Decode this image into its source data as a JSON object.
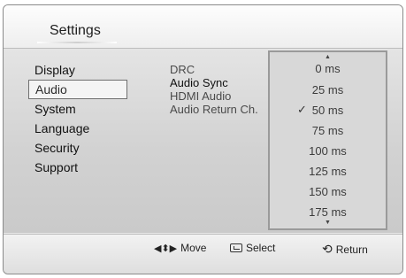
{
  "header": {
    "title": "Settings"
  },
  "menu": {
    "items": [
      {
        "label": "Display",
        "selected": false
      },
      {
        "label": "Audio",
        "selected": true
      },
      {
        "label": "System",
        "selected": false
      },
      {
        "label": "Language",
        "selected": false
      },
      {
        "label": "Security",
        "selected": false
      },
      {
        "label": "Support",
        "selected": false
      }
    ]
  },
  "submenu": {
    "items": [
      {
        "label": "DRC"
      },
      {
        "label": "Audio Sync"
      },
      {
        "label": "HDMI Audio"
      },
      {
        "label": "Audio Return Ch."
      }
    ],
    "active": "Audio Sync"
  },
  "dropdown": {
    "options": [
      "0 ms",
      "25 ms",
      "50 ms",
      "75 ms",
      "100 ms",
      "125 ms",
      "150 ms",
      "175 ms"
    ],
    "selected": "50 ms",
    "check_glyph": "✓",
    "up_arrow": "▲",
    "down_arrow": "▼"
  },
  "footer": {
    "move": {
      "icon": "◀⬍▶",
      "label": "Move"
    },
    "select": {
      "icon": "enter-icon",
      "label": "Select"
    },
    "return": {
      "icon": "⟲",
      "label": "Return"
    }
  }
}
